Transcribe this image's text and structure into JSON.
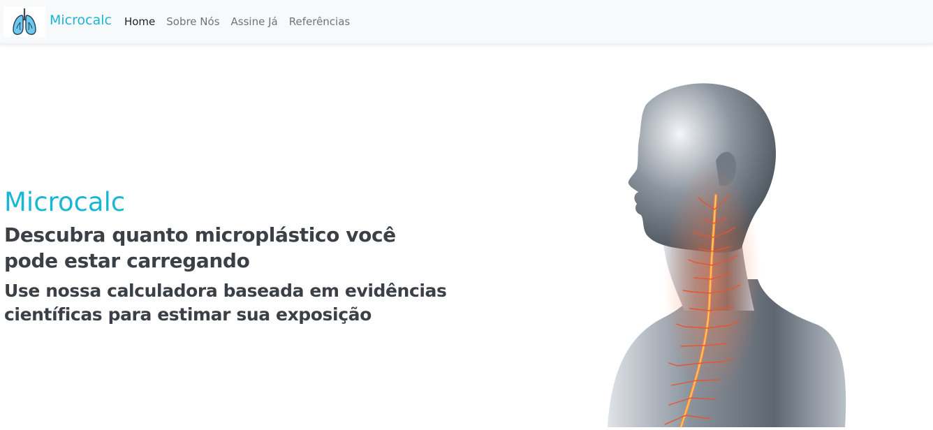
{
  "navbar": {
    "brand_name": "Microcalc",
    "logo_icon": "lungs-icon",
    "links": [
      {
        "label": "Home",
        "active": true
      },
      {
        "label": "Sobre Nós",
        "active": false
      },
      {
        "label": "Assine Já",
        "active": false
      },
      {
        "label": "Referências",
        "active": false
      }
    ]
  },
  "hero": {
    "title": "Microcalc",
    "subtitle": "Descubra quanto microplástico você pode estar carregando",
    "description": "Use nossa calculadora baseada em evidências científicas para estimar sua exposição",
    "illustration_icon": "human-respiratory-system-illustration"
  },
  "colors": {
    "brand": "#1ab6d6",
    "navbar_bg": "#f8f9fa",
    "nav_link": "#6c757d",
    "nav_link_active": "#1d2124",
    "heading_text": "#3b4046",
    "airway_highlight": "#e8542e"
  }
}
